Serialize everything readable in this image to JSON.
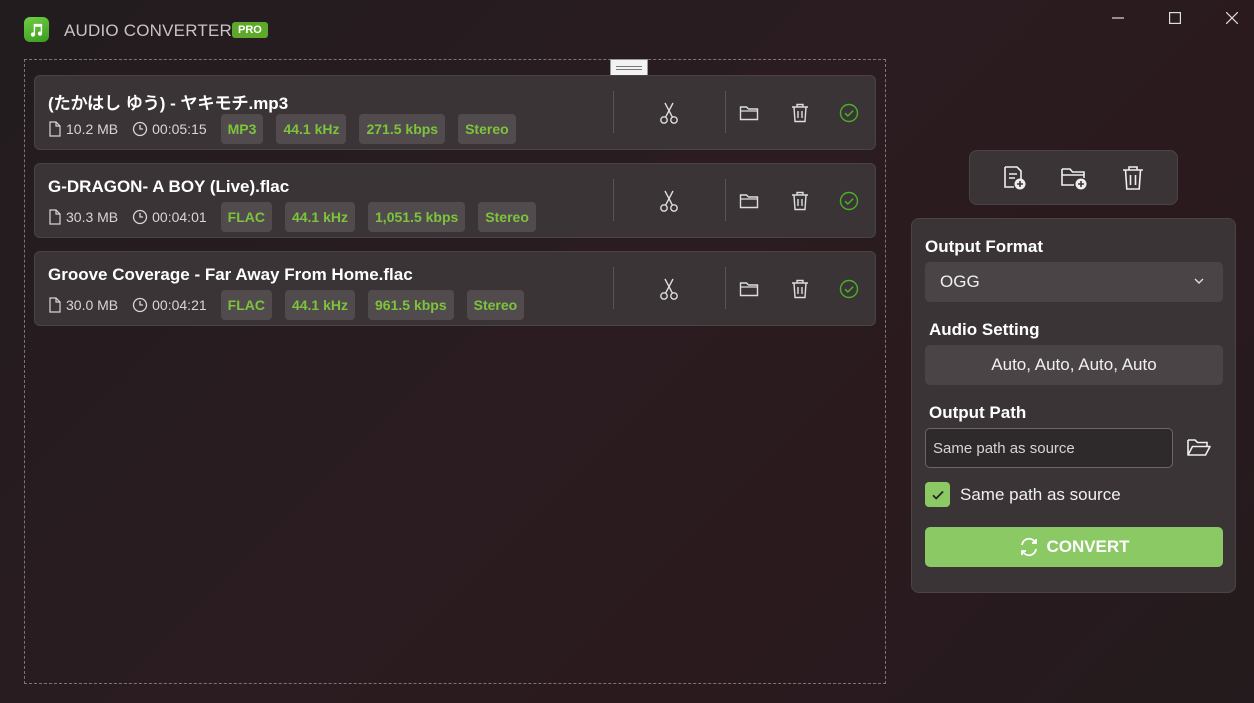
{
  "app": {
    "title": "AUDIO CONVERTER",
    "badge": "PRO"
  },
  "files": [
    {
      "name": "(たかはし ゆう) - ヤキモチ.mp3",
      "size": "10.2 MB",
      "duration": "00:05:15",
      "format": "MP3",
      "sample_rate": "44.1 kHz",
      "bitrate": "271.5 kbps",
      "channels": "Stereo"
    },
    {
      "name": "G-DRAGON- A BOY (Live).flac",
      "size": "30.3 MB",
      "duration": "00:04:01",
      "format": "FLAC",
      "sample_rate": "44.1 kHz",
      "bitrate": "1,051.5 kbps",
      "channels": "Stereo"
    },
    {
      "name": "Groove Coverage - Far Away From Home.flac",
      "size": "30.0 MB",
      "duration": "00:04:21",
      "format": "FLAC",
      "sample_rate": "44.1 kHz",
      "bitrate": "961.5 kbps",
      "channels": "Stereo"
    }
  ],
  "settings": {
    "output_format_label": "Output Format",
    "output_format_value": "OGG",
    "audio_setting_label": "Audio Setting",
    "audio_setting_value": "Auto, Auto, Auto, Auto",
    "output_path_label": "Output Path",
    "output_path_value": "Same path as source",
    "same_path_checkbox_label": "Same path as source",
    "same_path_checked": true,
    "convert_label": "CONVERT"
  },
  "colors": {
    "accent": "#8bc965",
    "tag_text": "#7bc43c",
    "card_bg": "#3a3436",
    "badge_bg": "#5ea92a"
  },
  "icons": {
    "toolbar": [
      "add-file-icon",
      "add-folder-icon",
      "clear-all-icon"
    ],
    "card": [
      "scissors-icon",
      "folder-icon",
      "trash-icon",
      "check-circle-icon"
    ]
  }
}
